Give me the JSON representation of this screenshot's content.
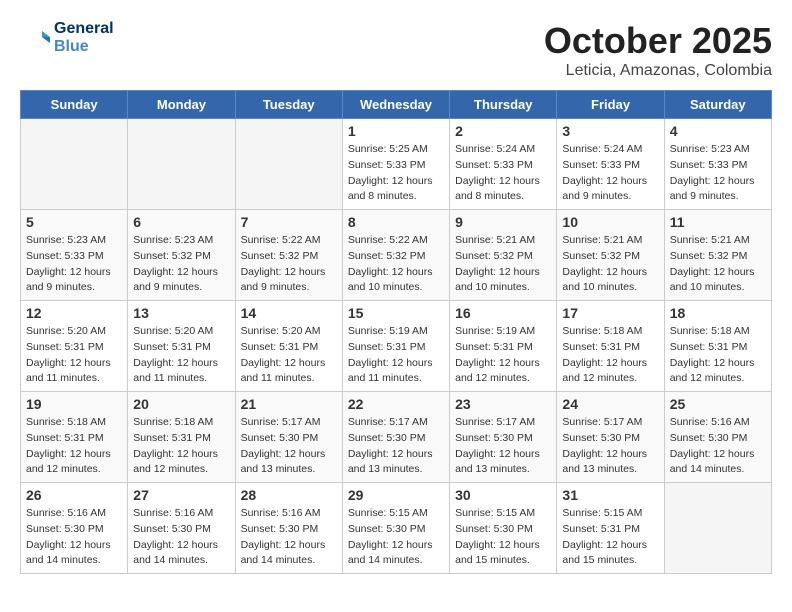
{
  "app": {
    "logo_line1": "General",
    "logo_line2": "Blue"
  },
  "header": {
    "month": "October 2025",
    "location": "Leticia, Amazonas, Colombia"
  },
  "weekdays": [
    "Sunday",
    "Monday",
    "Tuesday",
    "Wednesday",
    "Thursday",
    "Friday",
    "Saturday"
  ],
  "weeks": [
    [
      {
        "day": "",
        "info": ""
      },
      {
        "day": "",
        "info": ""
      },
      {
        "day": "",
        "info": ""
      },
      {
        "day": "1",
        "info": "Sunrise: 5:25 AM\nSunset: 5:33 PM\nDaylight: 12 hours\nand 8 minutes."
      },
      {
        "day": "2",
        "info": "Sunrise: 5:24 AM\nSunset: 5:33 PM\nDaylight: 12 hours\nand 8 minutes."
      },
      {
        "day": "3",
        "info": "Sunrise: 5:24 AM\nSunset: 5:33 PM\nDaylight: 12 hours\nand 9 minutes."
      },
      {
        "day": "4",
        "info": "Sunrise: 5:23 AM\nSunset: 5:33 PM\nDaylight: 12 hours\nand 9 minutes."
      }
    ],
    [
      {
        "day": "5",
        "info": "Sunrise: 5:23 AM\nSunset: 5:33 PM\nDaylight: 12 hours\nand 9 minutes."
      },
      {
        "day": "6",
        "info": "Sunrise: 5:23 AM\nSunset: 5:32 PM\nDaylight: 12 hours\nand 9 minutes."
      },
      {
        "day": "7",
        "info": "Sunrise: 5:22 AM\nSunset: 5:32 PM\nDaylight: 12 hours\nand 9 minutes."
      },
      {
        "day": "8",
        "info": "Sunrise: 5:22 AM\nSunset: 5:32 PM\nDaylight: 12 hours\nand 10 minutes."
      },
      {
        "day": "9",
        "info": "Sunrise: 5:21 AM\nSunset: 5:32 PM\nDaylight: 12 hours\nand 10 minutes."
      },
      {
        "day": "10",
        "info": "Sunrise: 5:21 AM\nSunset: 5:32 PM\nDaylight: 12 hours\nand 10 minutes."
      },
      {
        "day": "11",
        "info": "Sunrise: 5:21 AM\nSunset: 5:32 PM\nDaylight: 12 hours\nand 10 minutes."
      }
    ],
    [
      {
        "day": "12",
        "info": "Sunrise: 5:20 AM\nSunset: 5:31 PM\nDaylight: 12 hours\nand 11 minutes."
      },
      {
        "day": "13",
        "info": "Sunrise: 5:20 AM\nSunset: 5:31 PM\nDaylight: 12 hours\nand 11 minutes."
      },
      {
        "day": "14",
        "info": "Sunrise: 5:20 AM\nSunset: 5:31 PM\nDaylight: 12 hours\nand 11 minutes."
      },
      {
        "day": "15",
        "info": "Sunrise: 5:19 AM\nSunset: 5:31 PM\nDaylight: 12 hours\nand 11 minutes."
      },
      {
        "day": "16",
        "info": "Sunrise: 5:19 AM\nSunset: 5:31 PM\nDaylight: 12 hours\nand 12 minutes."
      },
      {
        "day": "17",
        "info": "Sunrise: 5:18 AM\nSunset: 5:31 PM\nDaylight: 12 hours\nand 12 minutes."
      },
      {
        "day": "18",
        "info": "Sunrise: 5:18 AM\nSunset: 5:31 PM\nDaylight: 12 hours\nand 12 minutes."
      }
    ],
    [
      {
        "day": "19",
        "info": "Sunrise: 5:18 AM\nSunset: 5:31 PM\nDaylight: 12 hours\nand 12 minutes."
      },
      {
        "day": "20",
        "info": "Sunrise: 5:18 AM\nSunset: 5:31 PM\nDaylight: 12 hours\nand 12 minutes."
      },
      {
        "day": "21",
        "info": "Sunrise: 5:17 AM\nSunset: 5:30 PM\nDaylight: 12 hours\nand 13 minutes."
      },
      {
        "day": "22",
        "info": "Sunrise: 5:17 AM\nSunset: 5:30 PM\nDaylight: 12 hours\nand 13 minutes."
      },
      {
        "day": "23",
        "info": "Sunrise: 5:17 AM\nSunset: 5:30 PM\nDaylight: 12 hours\nand 13 minutes."
      },
      {
        "day": "24",
        "info": "Sunrise: 5:17 AM\nSunset: 5:30 PM\nDaylight: 12 hours\nand 13 minutes."
      },
      {
        "day": "25",
        "info": "Sunrise: 5:16 AM\nSunset: 5:30 PM\nDaylight: 12 hours\nand 14 minutes."
      }
    ],
    [
      {
        "day": "26",
        "info": "Sunrise: 5:16 AM\nSunset: 5:30 PM\nDaylight: 12 hours\nand 14 minutes."
      },
      {
        "day": "27",
        "info": "Sunrise: 5:16 AM\nSunset: 5:30 PM\nDaylight: 12 hours\nand 14 minutes."
      },
      {
        "day": "28",
        "info": "Sunrise: 5:16 AM\nSunset: 5:30 PM\nDaylight: 12 hours\nand 14 minutes."
      },
      {
        "day": "29",
        "info": "Sunrise: 5:15 AM\nSunset: 5:30 PM\nDaylight: 12 hours\nand 14 minutes."
      },
      {
        "day": "30",
        "info": "Sunrise: 5:15 AM\nSunset: 5:30 PM\nDaylight: 12 hours\nand 15 minutes."
      },
      {
        "day": "31",
        "info": "Sunrise: 5:15 AM\nSunset: 5:31 PM\nDaylight: 12 hours\nand 15 minutes."
      },
      {
        "day": "",
        "info": ""
      }
    ]
  ]
}
